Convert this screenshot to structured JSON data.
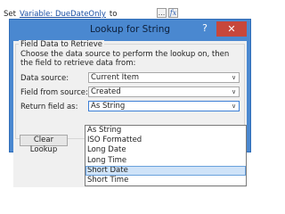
{
  "top": {
    "prefix": "Set",
    "variable_link": "Variable: DueDateOnly",
    "suffix": "to",
    "ellipsis_label": "...",
    "fx_label": "fx"
  },
  "dialog": {
    "title": "Lookup for String",
    "help_label": "?",
    "close_label": "✕",
    "group_title": "Field Data to Retrieve",
    "description": "Choose the data source to perform the lookup on, then the field to retrieve data from:",
    "data_source": {
      "label": "Data source:",
      "value": "Current Item"
    },
    "field_from_source": {
      "label": "Field from source:",
      "value": "Created"
    },
    "return_field_as": {
      "label": "Return field as:",
      "value": "As String",
      "options": [
        "As String",
        "ISO Formatted",
        "Long Date",
        "Long Time",
        "Short Date",
        "Short Time"
      ],
      "highlighted": "Short Date"
    },
    "clear_lookup_label": "Clear Lookup"
  },
  "colors": {
    "titlebar": "#4a88d0",
    "close_button": "#c7473b",
    "link": "#1a4fa3",
    "highlight": "#cfe3f8"
  }
}
